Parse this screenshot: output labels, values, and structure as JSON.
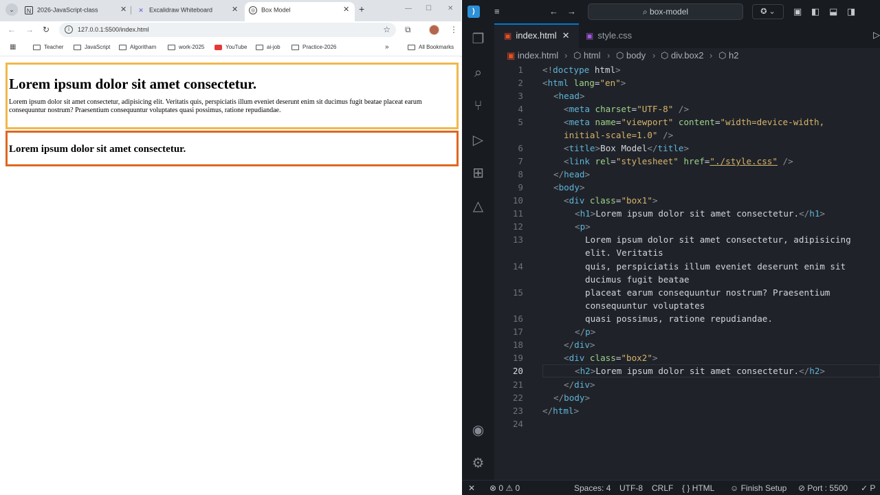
{
  "browser": {
    "tabs": [
      {
        "title": "2026-JavaScript-class",
        "icon": "notion-icon"
      },
      {
        "title": "Excalidraw Whiteboard",
        "icon": "excalidraw-icon"
      },
      {
        "title": "Box Model",
        "icon": "globe-icon"
      }
    ],
    "url": "127.0.0.1:5500/index.html",
    "bookmarks": [
      "Teacher",
      "JavaScript",
      "Algoritham",
      "work-2025",
      "YouTube",
      "ai-job",
      "Practice-2026"
    ],
    "all_bookmarks": "All Bookmarks",
    "more_bookmarks": "»",
    "page": {
      "box1_h1": "Lorem ipsum dolor sit amet consectetur.",
      "box1_p": "Lorem ipsum dolor sit amet consectetur, adipisicing elit. Veritatis quis, perspiciatis illum eveniet deserunt enim sit ducimus fugit beatae placeat earum consequuntur nostrum? Praesentium consequuntur voluptates quasi possimus, ratione repudiandae.",
      "box2_h2": "Lorem ipsum dolor sit amet consectetur.",
      "colors": {
        "box1_border": "#f0b84a",
        "box2_border": "#e0661f"
      }
    }
  },
  "vscode": {
    "search": "box-model",
    "tabs": [
      {
        "name": "index.html",
        "active": true
      },
      {
        "name": "style.css",
        "active": false
      }
    ],
    "breadcrumbs": [
      "index.html",
      "html",
      "body",
      "div.box2",
      "h2"
    ],
    "current_line": 20,
    "line_numbers": [
      "1",
      "2",
      "3",
      "4",
      "5",
      "",
      "6",
      "7",
      "8",
      "9",
      "10",
      "11",
      "12",
      "13",
      "",
      "14",
      "",
      "15",
      "",
      "16",
      "17",
      "18",
      "19",
      "20",
      "21",
      "22",
      "23",
      "24"
    ],
    "statusbar": {
      "errors": "0",
      "warnings": "0",
      "spaces": "Spaces: 4",
      "encoding": "UTF-8",
      "eol": "CRLF",
      "language": "HTML",
      "finish_setup": "Finish Setup",
      "port": "Port : 5500",
      "prettier": "P"
    }
  }
}
